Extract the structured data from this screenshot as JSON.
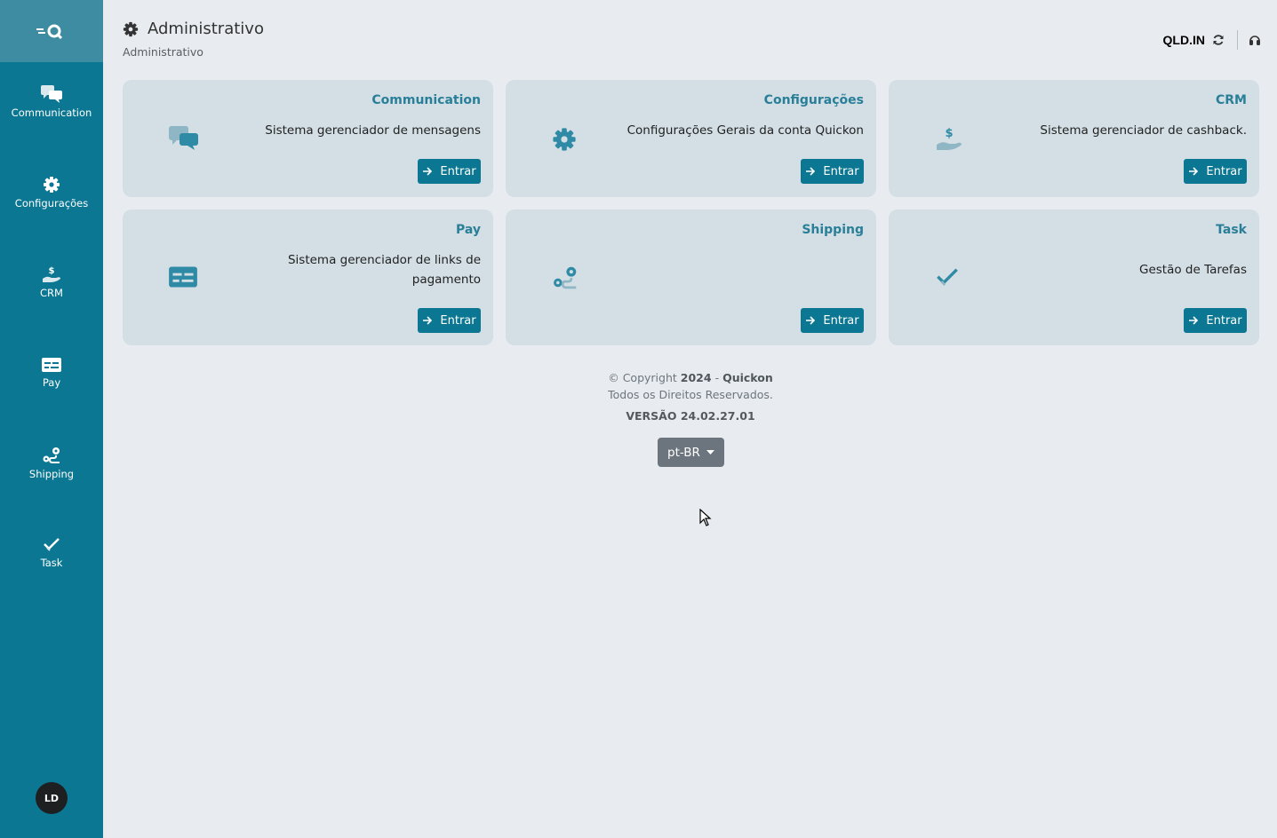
{
  "sidebar": {
    "logo_icon": "quickon-logo-icon",
    "items": [
      {
        "label": "Communication",
        "icon": "chat-bubbles-icon"
      },
      {
        "label": "Configurações",
        "icon": "gear-icon"
      },
      {
        "label": "CRM",
        "icon": "hand-dollar-icon"
      },
      {
        "label": "Pay",
        "icon": "payment-card-icon"
      },
      {
        "label": "Shipping",
        "icon": "route-pin-icon"
      },
      {
        "label": "Task",
        "icon": "double-check-icon"
      }
    ],
    "avatar_initials": "LD"
  },
  "header": {
    "title": "Administrativo",
    "title_icon": "gear-icon",
    "breadcrumb": "Administrativo"
  },
  "topbar": {
    "domain": "QLD.IN",
    "refresh_icon": "refresh-icon",
    "support_icon": "headset-icon"
  },
  "cards": [
    {
      "title": "Communication",
      "description": "Sistema gerenciador de mensagens",
      "button": "Entrar",
      "icon": "chat-bubbles-icon"
    },
    {
      "title": "Configurações",
      "description": "Configurações Gerais da conta Quickon",
      "button": "Entrar",
      "icon": "gear-icon"
    },
    {
      "title": "CRM",
      "description": "Sistema gerenciador de cashback.",
      "button": "Entrar",
      "icon": "hand-dollar-icon"
    },
    {
      "title": "Pay",
      "description": "Sistema gerenciador de links de pagamento",
      "button": "Entrar",
      "icon": "payment-card-icon"
    },
    {
      "title": "Shipping",
      "description": "",
      "button": "Entrar",
      "icon": "route-pin-icon"
    },
    {
      "title": "Task",
      "description": "Gestão de Tarefas",
      "button": "Entrar",
      "icon": "double-check-icon"
    }
  ],
  "footer": {
    "copyright_prefix": "© Copyright",
    "year": "2024",
    "dash": "-",
    "company": "Quickon",
    "rights": "Todos os Direitos Reservados.",
    "version": "VERSÃO 24.02.27.01"
  },
  "language": {
    "selected": "pt-BR"
  },
  "colors": {
    "sidebar": "#0b7792",
    "accent": "#297f98",
    "card": "#d3dfe5",
    "background": "#e8ecf0"
  }
}
